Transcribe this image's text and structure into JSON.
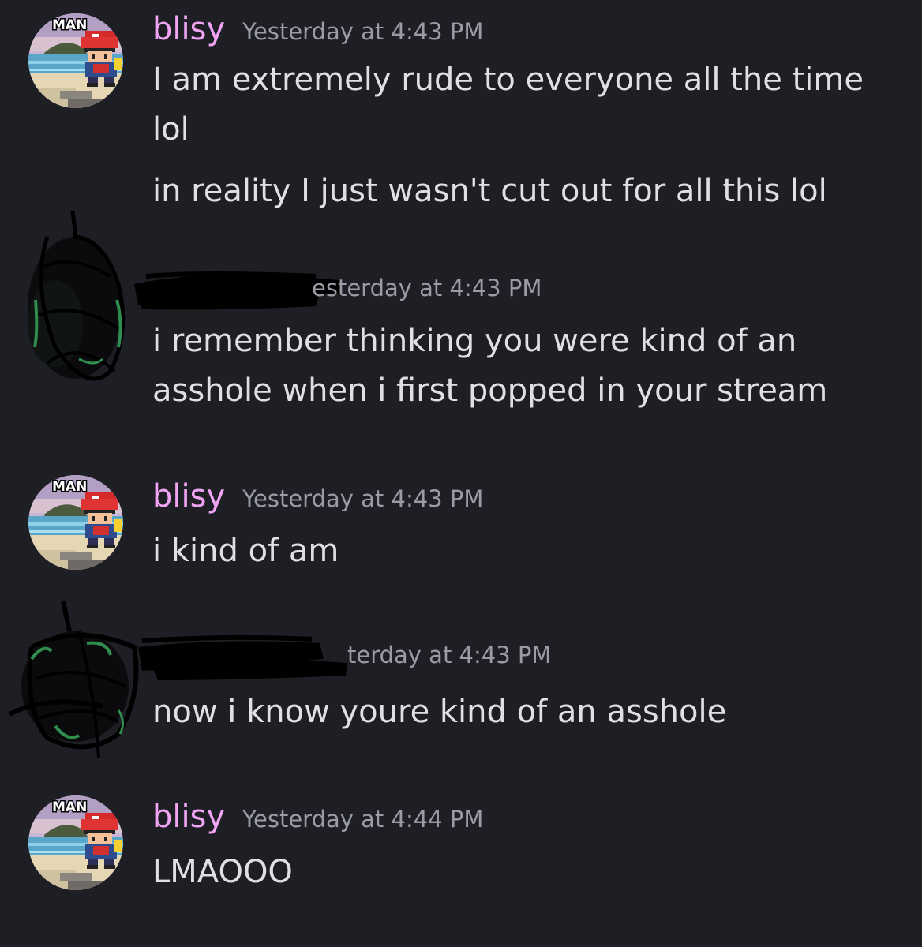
{
  "colors": {
    "background": "#1e1f24",
    "username": "#f0a4f3",
    "timestamp": "#9a9ba5",
    "message_text": "#dfe0e4"
  },
  "messages": [
    {
      "avatar_tag": "MAN",
      "username": "blisy",
      "timestamp": "Yesterday at 4:43 PM",
      "lines": [
        "I am extremely rude to everyone all the time",
        "lol",
        "in reality I just wasn't cut out for all this lol"
      ]
    },
    {
      "timestamp_visible": "esterday at 4:43 PM",
      "lines": [
        "i remember thinking you were kind of an",
        "asshole when i first popped in your stream"
      ]
    },
    {
      "avatar_tag": "MAN",
      "username": "blisy",
      "timestamp": "Yesterday at 4:43 PM",
      "lines": [
        "i kind of am"
      ]
    },
    {
      "timestamp_visible": "terday at 4:43 PM",
      "lines": [
        "now i know youre kind of an asshole"
      ]
    },
    {
      "avatar_tag": "MAN",
      "username": "blisy",
      "timestamp": "Yesterday at 4:44 PM",
      "lines": [
        "LMAOOO"
      ]
    }
  ]
}
